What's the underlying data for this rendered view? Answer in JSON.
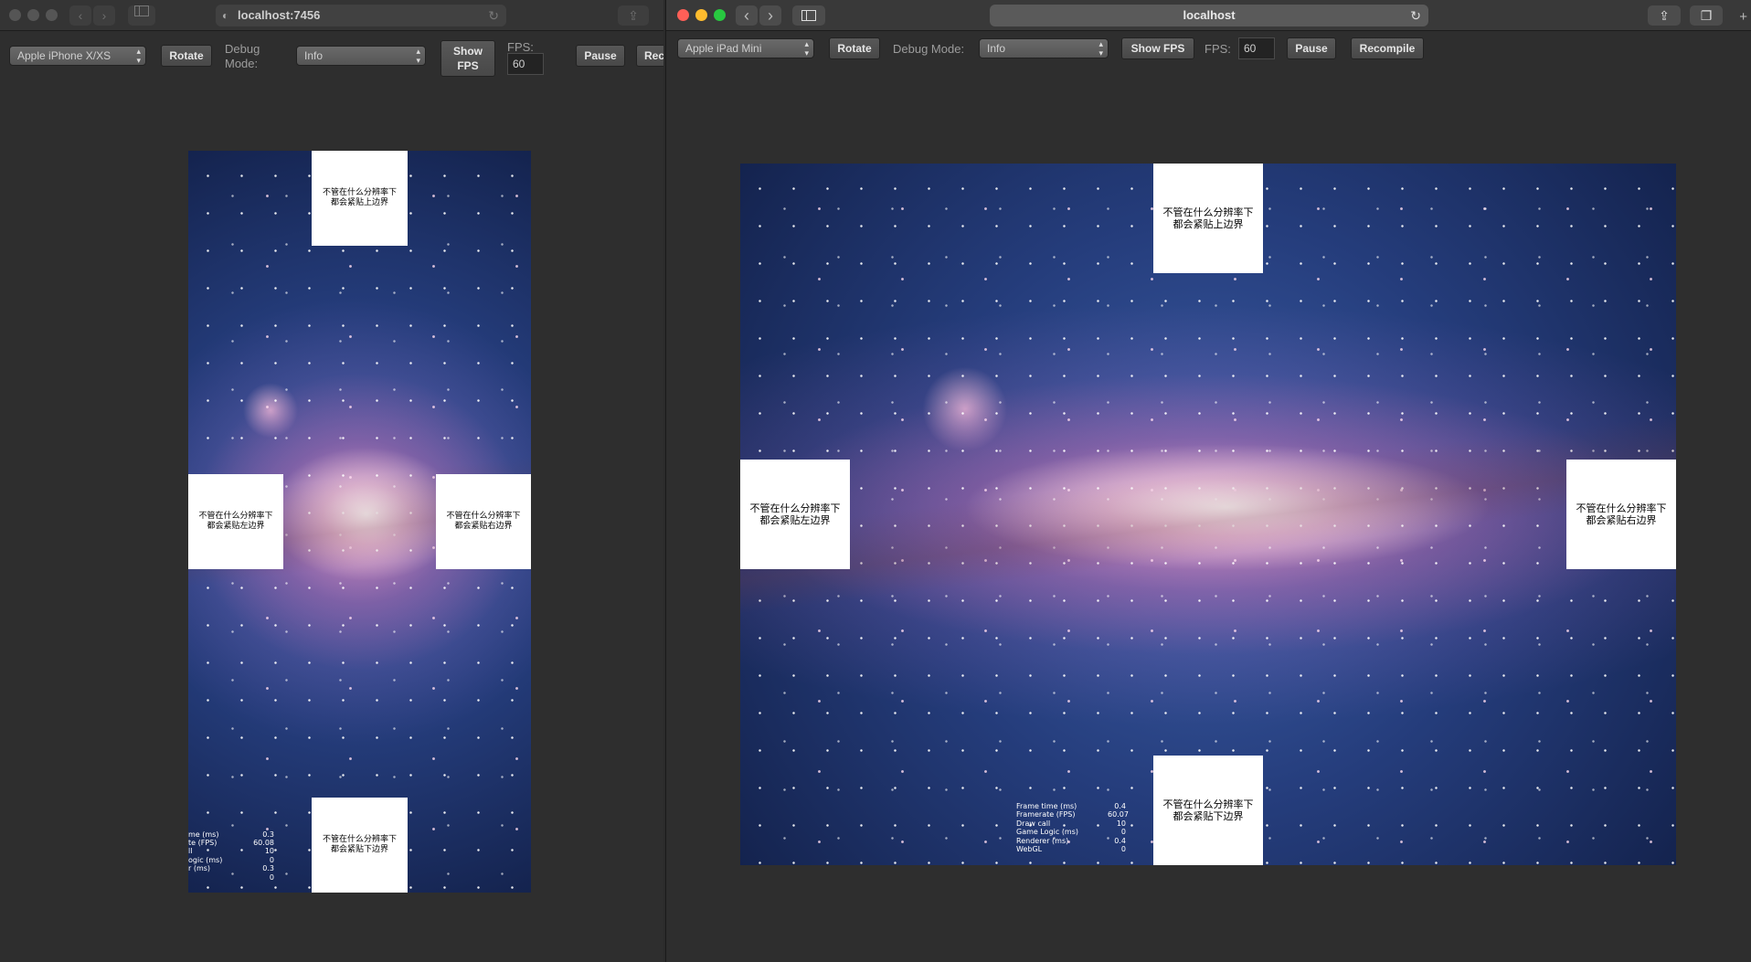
{
  "left_window": {
    "url": "localhost:7456",
    "toolbar": {
      "device": "Apple iPhone X/XS",
      "rotate_label": "Rotate",
      "debug_mode_label": "Debug\nMode:",
      "debug_mode_value": "Info",
      "show_fps_label": "Show\nFPS",
      "fps_label": "FPS:",
      "fps_value": "60",
      "pause_label": "Pause",
      "recompile_label": "Rec"
    },
    "canvas": {
      "top_label": "不管在什么分辨率下\n都会紧贴上边界",
      "left_label": "不管在什么分辨率下\n都会紧贴左边界",
      "right_label": "不管在什么分辨率下\n都会紧贴右边界",
      "bottom_label": "不管在什么分辨率下\n都会紧贴下边界",
      "stats": [
        {
          "k": "me (ms)",
          "v": "0.3"
        },
        {
          "k": "te (FPS)",
          "v": "60.08"
        },
        {
          "k": "ll",
          "v": "10"
        },
        {
          "k": "ogic (ms)",
          "v": "0"
        },
        {
          "k": "r (ms)",
          "v": "0.3"
        },
        {
          "k": "",
          "v": "0"
        }
      ]
    }
  },
  "right_window": {
    "url": "localhost",
    "toolbar": {
      "device": "Apple iPad Mini",
      "rotate_label": "Rotate",
      "debug_mode_label": "Debug Mode:",
      "debug_mode_value": "Info",
      "show_fps_label": "Show FPS",
      "fps_label": "FPS:",
      "fps_value": "60",
      "pause_label": "Pause",
      "recompile_label": "Recompile"
    },
    "canvas": {
      "top_label": "不管在什么分辨率下\n都会紧贴上边界",
      "left_label": "不管在什么分辨率下\n都会紧贴左边界",
      "right_label": "不管在什么分辨率下\n都会紧贴右边界",
      "bottom_label": "不管在什么分辨率下\n都会紧贴下边界",
      "stats": [
        {
          "k": "Frame time (ms)",
          "v": "0.4"
        },
        {
          "k": "Framerate (FPS)",
          "v": "60.07"
        },
        {
          "k": "Draw call",
          "v": "10"
        },
        {
          "k": "Game Logic (ms)",
          "v": "0"
        },
        {
          "k": "Renderer (ms)",
          "v": "0.4"
        },
        {
          "k": "WebGL",
          "v": "0"
        }
      ]
    }
  },
  "icons": {
    "back": "chevron-left-icon",
    "forward": "chevron-right-icon",
    "sidebar": "sidebar-icon",
    "share": "share-icon",
    "tabs": "tabs-icon",
    "reload": "reload-icon",
    "new_tab": "plus-icon"
  }
}
